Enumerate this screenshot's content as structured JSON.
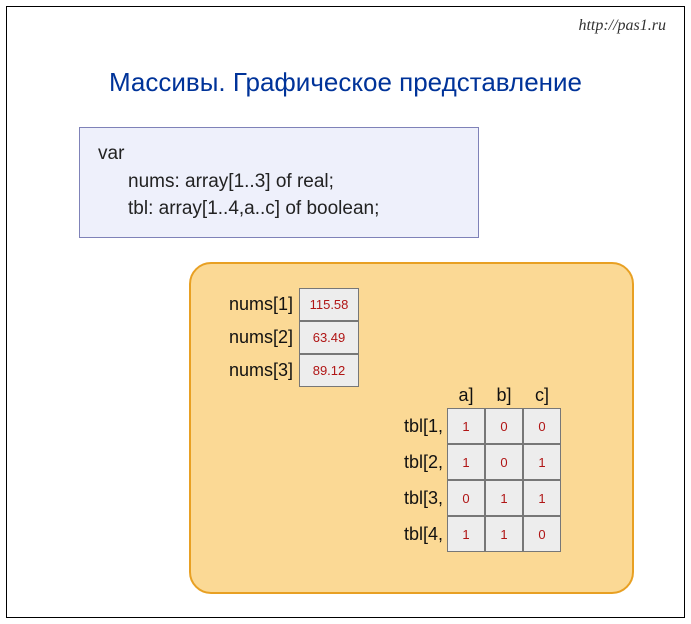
{
  "watermark": "http://pas1.ru",
  "title": "Массивы. Графическое представление",
  "code": {
    "line1": "var",
    "line2": "nums: array[1..3] of real;",
    "line3": "tbl: array[1..4,a..c] of boolean;"
  },
  "nums": {
    "labels": [
      "nums[1]",
      "nums[2]",
      "nums[3]"
    ],
    "values": [
      "115.58",
      "63.49",
      "89.12"
    ]
  },
  "tbl": {
    "col_headers": [
      "a]",
      "b]",
      "c]"
    ],
    "row_headers": [
      "tbl[1,",
      "tbl[2,",
      "tbl[3,",
      "tbl[4,"
    ],
    "cells": [
      [
        "1",
        "0",
        "0"
      ],
      [
        "1",
        "0",
        "1"
      ],
      [
        "0",
        "1",
        "1"
      ],
      [
        "1",
        "1",
        "0"
      ]
    ]
  }
}
